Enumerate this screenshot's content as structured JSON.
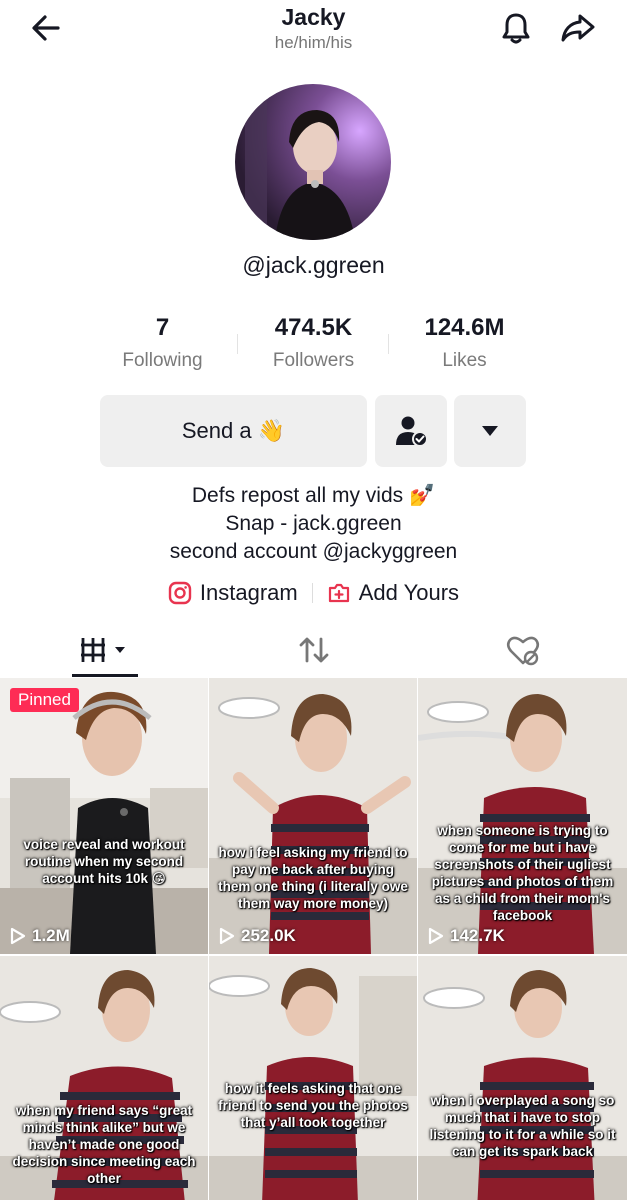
{
  "header": {
    "title": "Jacky",
    "pronouns": "he/him/his"
  },
  "profile": {
    "username": "@jack.ggreen"
  },
  "stats": [
    {
      "value": "7",
      "label": "Following"
    },
    {
      "value": "474.5K",
      "label": "Followers"
    },
    {
      "value": "124.6M",
      "label": "Likes"
    }
  ],
  "actions": {
    "send_label": "Send a 👋"
  },
  "bio": {
    "line1": "Defs repost all my vids 💅",
    "line2": "Snap - jack.ggreen",
    "line3": "second account @jackyggreen"
  },
  "links": {
    "instagram": "Instagram",
    "add_yours": "Add Yours"
  },
  "colors": {
    "accent": "#fe2c55",
    "text": "#161823",
    "muted": "#7a7a7a",
    "button_bg": "#efefef"
  },
  "videos": [
    {
      "pinned_label": "Pinned",
      "caption": "voice reveal and workout routine when my second account hits 10k 😘",
      "views": "1.2M"
    },
    {
      "caption": "how i feel asking my friend to pay me back after buying them one thing (i literally owe them way more money)",
      "views": "252.0K"
    },
    {
      "caption": "when someone is trying to come for me but i have screenshots of their ugliest pictures and photos of them as a child from their mom's facebook",
      "views": "142.7K"
    },
    {
      "caption": "when my friend says “great minds think alike” but we haven’t made one good decision since meeting each other",
      "views": ""
    },
    {
      "caption": "how it feels asking that one friend to send you the photos that y’all took together",
      "views": ""
    },
    {
      "caption": "when i overplayed a song so much that i have to stop listening to it for a while so it can get its spark back",
      "views": ""
    }
  ]
}
